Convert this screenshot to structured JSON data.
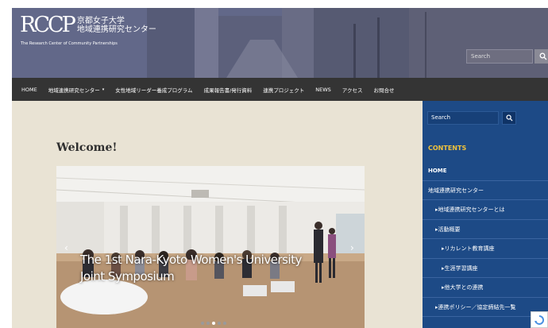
{
  "header": {
    "logo_mark": "RCCP",
    "title_line1": "京都女子大学",
    "title_line2": "地域連携研究センター",
    "subtitle": "The Research Center of Community Partnerships",
    "search_placeholder": "Search",
    "search_icon": "search-icon"
  },
  "nav": {
    "items": [
      {
        "label": "HOME"
      },
      {
        "label": "地域連携研究センター",
        "caret": "▾"
      },
      {
        "label": "女性地域リーダー養成プログラム"
      },
      {
        "label": "成果報告書/発行資料"
      },
      {
        "label": "連携プロジェクト"
      },
      {
        "label": "NEWS"
      },
      {
        "label": "アクセス"
      },
      {
        "label": "お問合せ"
      }
    ]
  },
  "main": {
    "welcome": "Welcome!",
    "slide": {
      "caption_line1": "The 1st Nara-Kyoto Women's University",
      "caption_line2": "Joint Symposium",
      "prev_icon": "chevron-left-icon",
      "next_icon": "chevron-right-icon",
      "dot_count": 5,
      "active_dot": 3
    }
  },
  "sidebar": {
    "search_placeholder": "Search",
    "search_icon": "search-icon",
    "contents_label": "CONTENTS",
    "items": [
      {
        "label": "HOME",
        "indent": 0
      },
      {
        "label": "地域連携研究センター",
        "indent": 0
      },
      {
        "label": "▸地域連携研究センターとは",
        "indent": 1
      },
      {
        "label": "▸活動概要",
        "indent": 1
      },
      {
        "label": "▸リカレント教育講座",
        "indent": 2
      },
      {
        "label": "▸生涯学習講座",
        "indent": 2
      },
      {
        "label": "▸他大学との連携",
        "indent": 2
      },
      {
        "label": "▸連携ポリシー／協定締結先一覧",
        "indent": 1
      }
    ]
  },
  "colors": {
    "nav_bg": "#343434",
    "main_bg": "#e9e3d4",
    "sidebar_bg": "#1d4a86",
    "contents_accent": "#f0c23c"
  }
}
